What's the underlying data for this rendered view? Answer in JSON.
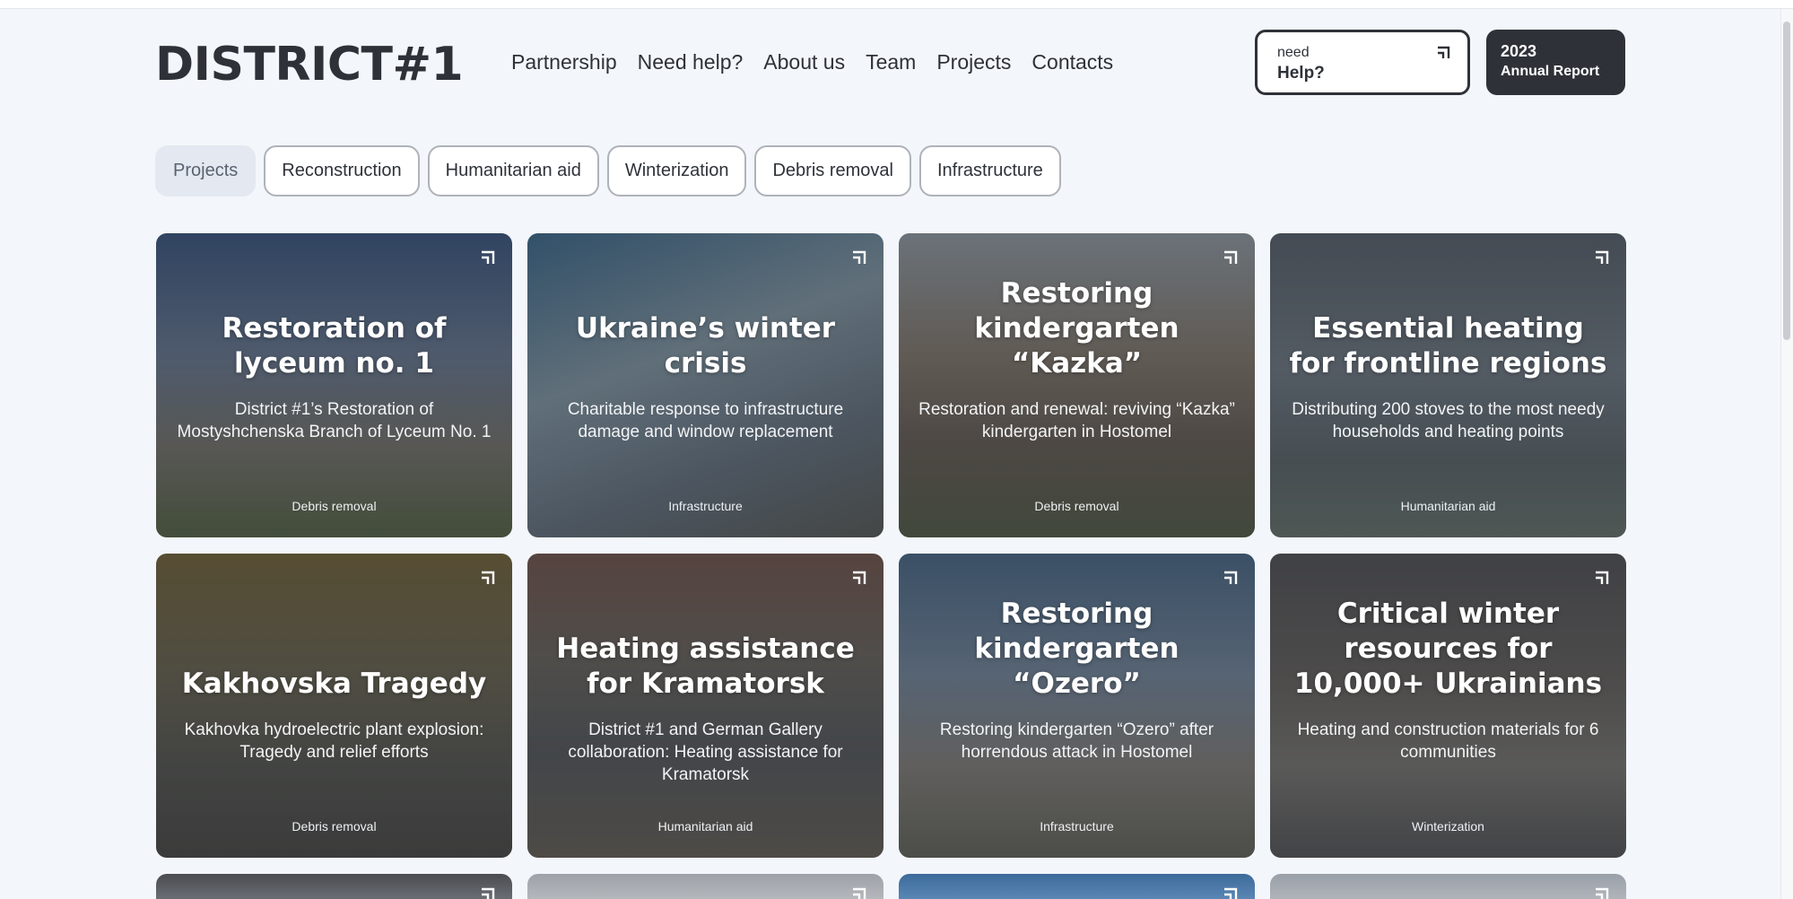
{
  "header": {
    "logo": "DISTRICT#1",
    "nav": [
      "Partnership",
      "Need help?",
      "About us",
      "Team",
      "Projects",
      "Contacts"
    ],
    "help_button": {
      "line1": "need",
      "line2": "Help?",
      "icon": "arrow-up-right-icon"
    },
    "report_button": {
      "line1": "2023",
      "line2": "Annual Report"
    }
  },
  "filters": [
    {
      "label": "Projects",
      "active": true
    },
    {
      "label": "Reconstruction",
      "active": false
    },
    {
      "label": "Humanitarian aid",
      "active": false
    },
    {
      "label": "Winterization",
      "active": false
    },
    {
      "label": "Debris removal",
      "active": false
    },
    {
      "label": "Infrastructure",
      "active": false
    }
  ],
  "cards": [
    {
      "title": "Restoration of lyceum no. 1",
      "description": "District #1’s Restoration of Mostyshchenska Branch of Lyceum No. 1",
      "tag": "Debris removal"
    },
    {
      "title": "Ukraine’s winter crisis",
      "description": "Charitable response to infrastructure damage and window replacement",
      "tag": "Infrastructure"
    },
    {
      "title": "Restoring kindergarten “Kazka”",
      "description": "Restoration and renewal: reviving “Kazka” kindergarten in Hostomel",
      "tag": "Debris removal"
    },
    {
      "title": "Essential heating for frontline regions",
      "description": "Distributing 200 stoves to the most needy households and heating points",
      "tag": "Humanitarian aid"
    },
    {
      "title": "Kakhovska Tragedy",
      "description": "Kakhovka hydroelectric plant explosion: Tragedy and relief efforts",
      "tag": "Debris removal"
    },
    {
      "title": "Heating assistance for Kramatorsk",
      "description": "District #1 and German Gallery collaboration: Heating assistance for Kramatorsk",
      "tag": "Humanitarian aid"
    },
    {
      "title": "Restoring kindergarten “Ozero”",
      "description": "Restoring kindergarten “Ozero” after horrendous attack in Hostomel",
      "tag": "Infrastructure"
    },
    {
      "title": "Critical winter resources for 10,000+ Ukrainians",
      "description": "Heating and construction materials for 6 communities",
      "tag": "Winterization"
    }
  ],
  "colors": {
    "dark": "#2e3238",
    "background": "#f3f6fa",
    "chip_active": "#e4e9f1"
  }
}
